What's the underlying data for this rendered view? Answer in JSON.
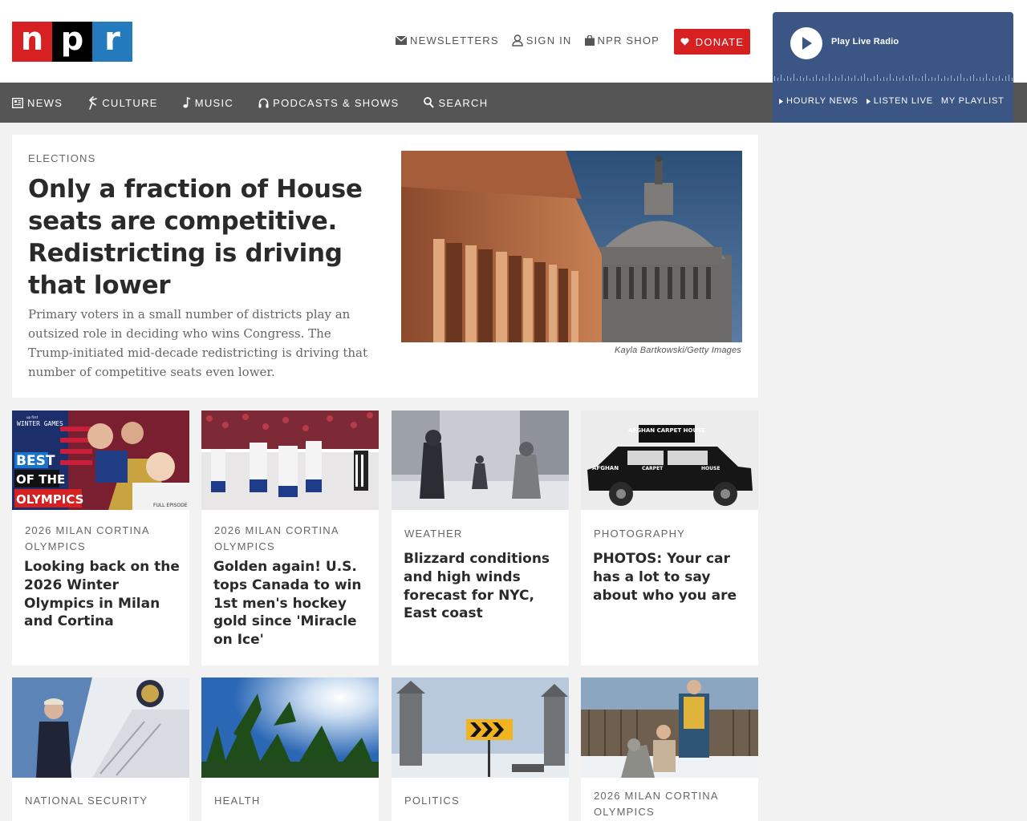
{
  "logo": {
    "n": "n",
    "p": "p",
    "r": "r"
  },
  "utility_nav": {
    "newsletters": "NEWSLETTERS",
    "sign_in": "SIGN IN",
    "npr_shop": "NPR SHOP",
    "donate": "DONATE"
  },
  "player": {
    "play_label": "Play Live Radio",
    "links": [
      "HOURLY NEWS",
      "LISTEN LIVE",
      "MY PLAYLIST"
    ]
  },
  "main_nav": {
    "news": "NEWS",
    "culture": "CULTURE",
    "music": "MUSIC",
    "podcasts": "PODCASTS & SHOWS",
    "search": "SEARCH"
  },
  "featured": {
    "kicker": "ELECTIONS",
    "headline": "Only a fraction of House seats are competitive. Redistricting is driving that lower",
    "teaser": "Primary voters in a small number of districts play an outsized role in deciding who wins Congress. The Trump-initiated mid-decade redistricting is driving that number of competitive seats even lower.",
    "credit": "Kayla Bartkowski/Getty Images"
  },
  "cards": [
    {
      "kicker": "2026 MILAN CORTINA OLYMPICS",
      "headline": "Looking back on the 2026 Winter Olympics in Milan and Cortina",
      "thumb_text": {
        "top": "WINTER GAMES",
        "best": "BEST",
        "of": "OF THE",
        "olympics": "OLYMPICS",
        "full": "FULL EPISODE"
      }
    },
    {
      "kicker": "2026 MILAN CORTINA OLYMPICS",
      "headline": "Golden again! U.S. tops Canada to win 1st men's hockey gold since 'Miracle on Ice'"
    },
    {
      "kicker": "WEATHER",
      "headline": "Blizzard conditions and high winds forecast for NYC, East coast"
    },
    {
      "kicker": "PHOTOGRAPHY",
      "headline": "PHOTOS: Your car has a lot to say about who you are",
      "thumb_text": {
        "sign": "AFGHAN CARPET HOUSE",
        "side1": "AFGHAN",
        "side2": "CARPET",
        "side3": "HOUSE"
      }
    },
    {
      "kicker": "NATIONAL SECURITY",
      "headline": ""
    },
    {
      "kicker": "HEALTH",
      "headline": ""
    },
    {
      "kicker": "POLITICS",
      "headline": ""
    },
    {
      "kicker": "2026 MILAN CORTINA OLYMPICS",
      "headline": ""
    }
  ],
  "colors": {
    "npr_red": "#d62021",
    "npr_blue": "#237bbd",
    "nav_gray": "#555555",
    "player_blue": "#3b5584"
  },
  "icons": [
    "newsletter-icon",
    "user-icon",
    "shop-bag-icon",
    "heart-icon",
    "play-icon",
    "news-icon",
    "culture-icon",
    "music-note-icon",
    "headphones-icon",
    "search-icon"
  ]
}
